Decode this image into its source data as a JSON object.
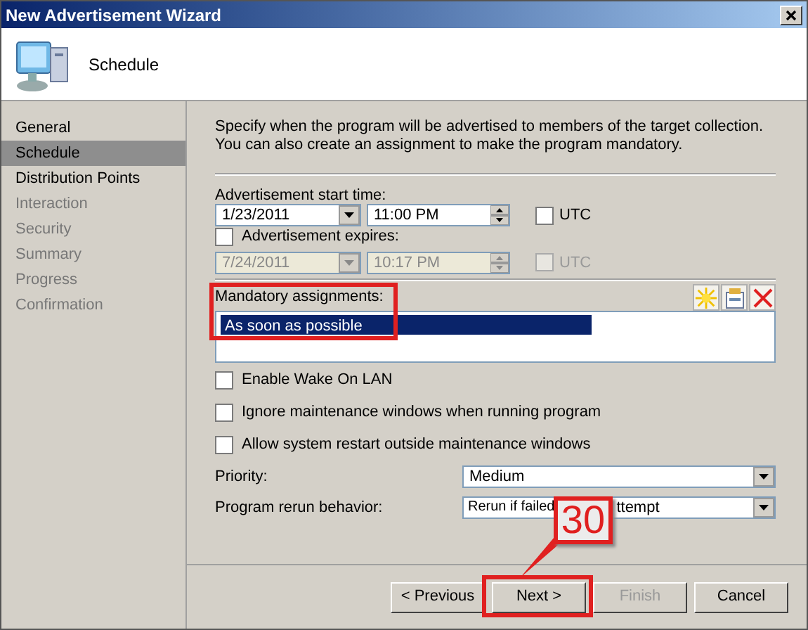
{
  "window": {
    "title": "New Advertisement Wizard"
  },
  "header": {
    "title": "Schedule"
  },
  "steps": [
    {
      "label": "General",
      "selected": false,
      "disabled": false
    },
    {
      "label": "Schedule",
      "selected": true,
      "disabled": false
    },
    {
      "label": "Distribution Points",
      "selected": false,
      "disabled": false
    },
    {
      "label": "Interaction",
      "selected": false,
      "disabled": true
    },
    {
      "label": "Security",
      "selected": false,
      "disabled": true
    },
    {
      "label": "Summary",
      "selected": false,
      "disabled": true
    },
    {
      "label": "Progress",
      "selected": false,
      "disabled": true
    },
    {
      "label": "Confirmation",
      "selected": false,
      "disabled": true
    }
  ],
  "description": "Specify when the program will be advertised to members of the target collection. You can also create an assignment to make the program mandatory.",
  "start_time": {
    "label": "Advertisement start time:",
    "date": "1/23/2011",
    "time": "11:00 PM",
    "utc": {
      "label": "UTC",
      "checked": false
    }
  },
  "expires": {
    "label": "Advertisement expires:",
    "checked": false,
    "date": "7/24/2011",
    "time": "10:17 PM",
    "disabled": true,
    "utc": {
      "label": "UTC",
      "checked": false
    }
  },
  "assignments": {
    "label": "Mandatory assignments:",
    "items": [
      {
        "label": "As soon as possible",
        "selected": true
      }
    ]
  },
  "options": [
    {
      "label": "Enable Wake On LAN",
      "checked": false
    },
    {
      "label": "Ignore maintenance windows when running program",
      "checked": false
    },
    {
      "label": "Allow system restart outside maintenance windows",
      "checked": false
    }
  ],
  "priority": {
    "label": "Priority:",
    "value": "Medium"
  },
  "rerun": {
    "label": "Program rerun behavior:",
    "value_parts": [
      "Rerun if failed",
      "ttempt"
    ]
  },
  "buttons": [
    {
      "label": "< Previous",
      "disabled": false
    },
    {
      "label": "Next >",
      "disabled": false
    },
    {
      "label": "Finish",
      "disabled": true
    },
    {
      "label": "Cancel",
      "disabled": false
    }
  ],
  "callout": {
    "label": "30"
  }
}
